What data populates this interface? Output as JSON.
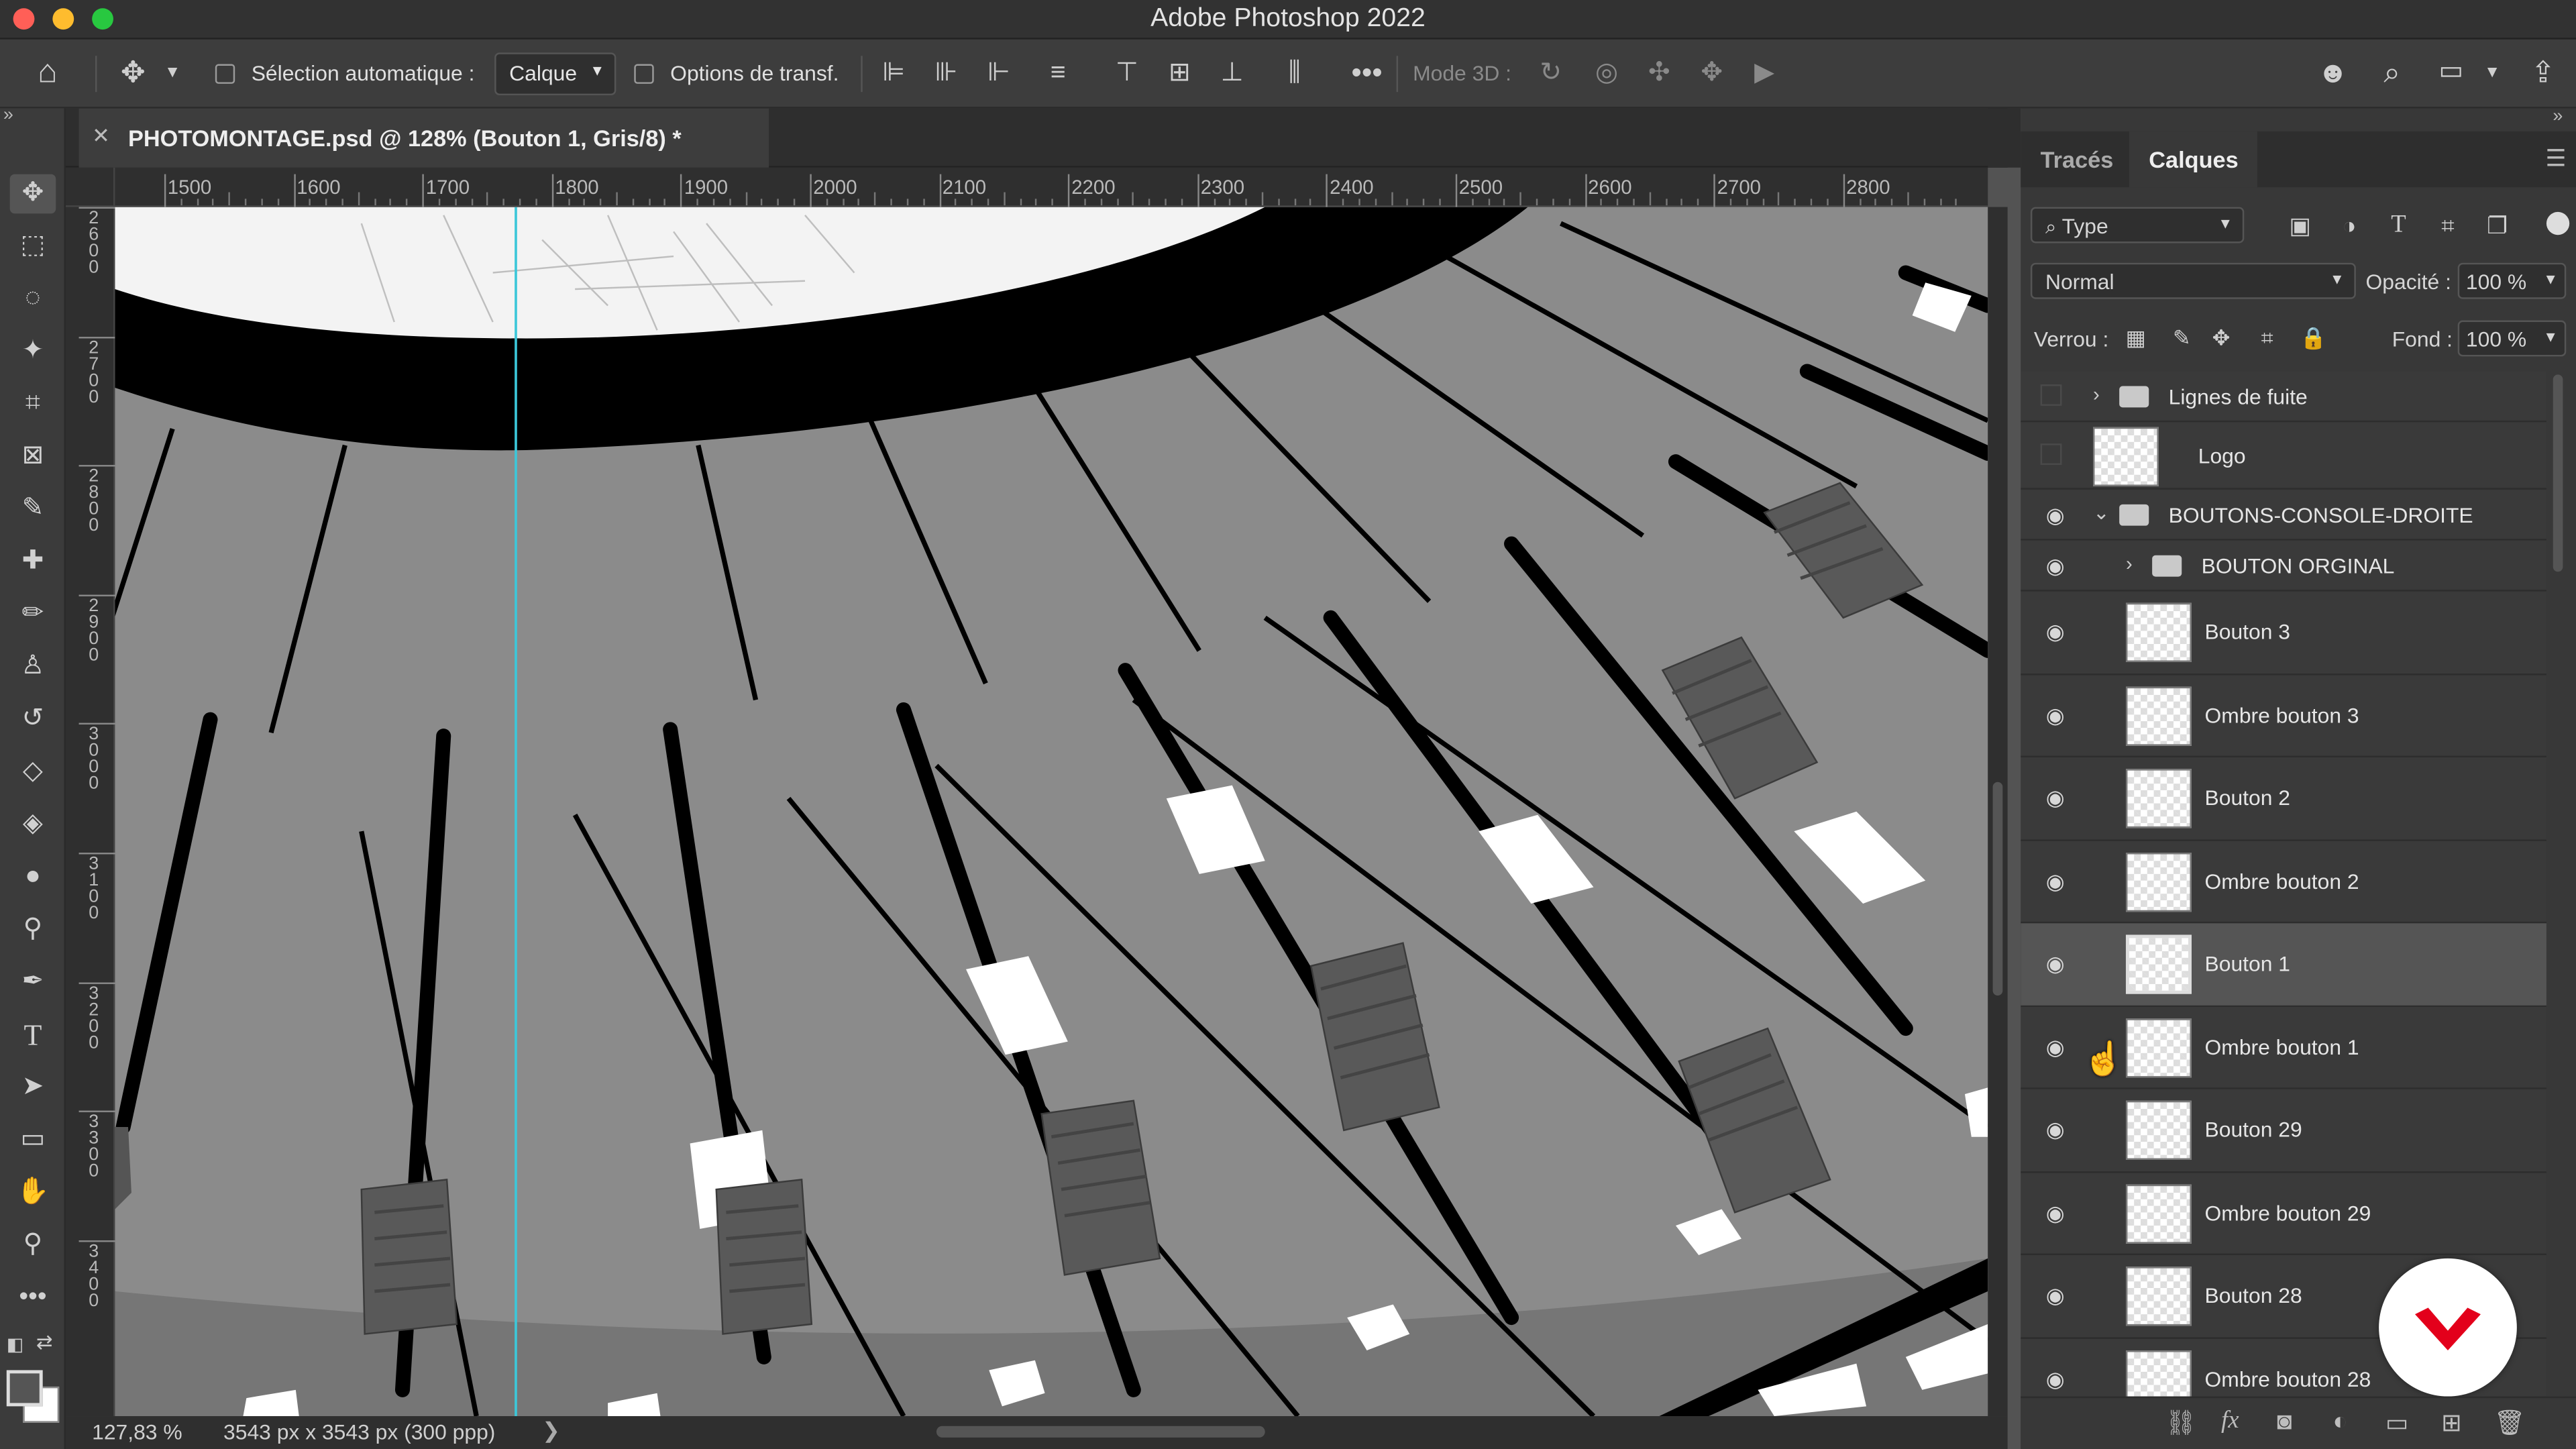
{
  "window": {
    "title": "Adobe Photoshop 2022"
  },
  "options_bar": {
    "auto_select_label": "Sélection automatique :",
    "auto_select_value": "Calque",
    "transform_options_label": "Options de transf.",
    "mode_3d_label": "Mode 3D :"
  },
  "document": {
    "tab_title": "PHOTOMONTAGE.psd @ 128% (Bouton 1, Gris/8) *",
    "ruler_ticks": [
      "1500",
      "1600",
      "1700",
      "1800",
      "1900",
      "2000",
      "2100",
      "2200",
      "2300",
      "2400",
      "2500",
      "2600",
      "2700",
      "2800"
    ],
    "vertical_ruler_ticks": [
      "2600",
      "2700",
      "2800",
      "2900",
      "3000",
      "3100",
      "3200",
      "3300",
      "3400"
    ],
    "zoom": "127,83 %",
    "dimensions": "3543 px x 3543 px (300 ppp)"
  },
  "panel": {
    "tabs": [
      "Tracés",
      "Calques"
    ],
    "active_tab": "Calques",
    "filter_label": "Type",
    "blend_mode": "Normal",
    "opacity_label": "Opacité :",
    "opacity_value": "100 %",
    "lock_label": "Verrou :",
    "fill_label": "Fond :",
    "fill_value": "100 %",
    "layers": [
      {
        "name": "Lignes de fuite",
        "kind": "group",
        "visible": false,
        "expanded": false,
        "indent": 0
      },
      {
        "name": "Logo",
        "kind": "layer",
        "visible": false,
        "indent": 0
      },
      {
        "name": "BOUTONS-CONSOLE-DROITE",
        "kind": "group",
        "visible": true,
        "expanded": true,
        "indent": 0
      },
      {
        "name": "BOUTON ORGINAL",
        "kind": "group",
        "visible": true,
        "expanded": false,
        "indent": 1
      },
      {
        "name": "Bouton 3",
        "kind": "layer",
        "visible": true,
        "indent": 1
      },
      {
        "name": "Ombre bouton 3",
        "kind": "layer",
        "visible": true,
        "indent": 1
      },
      {
        "name": "Bouton 2",
        "kind": "layer",
        "visible": true,
        "indent": 1
      },
      {
        "name": "Ombre bouton 2",
        "kind": "layer",
        "visible": true,
        "indent": 1
      },
      {
        "name": "Bouton 1",
        "kind": "layer",
        "visible": true,
        "indent": 1,
        "selected": true
      },
      {
        "name": "Ombre bouton 1",
        "kind": "layer",
        "visible": true,
        "indent": 1
      },
      {
        "name": "Bouton 29",
        "kind": "layer",
        "visible": true,
        "indent": 1
      },
      {
        "name": "Ombre bouton 29",
        "kind": "layer",
        "visible": true,
        "indent": 1
      },
      {
        "name": "Bouton 28",
        "kind": "layer",
        "visible": true,
        "indent": 1
      },
      {
        "name": "Ombre bouton 28",
        "kind": "layer",
        "visible": true,
        "indent": 1
      }
    ]
  },
  "colors": {
    "accent_red": "#e3001b",
    "guide_cyan": "#3cc7d9"
  }
}
